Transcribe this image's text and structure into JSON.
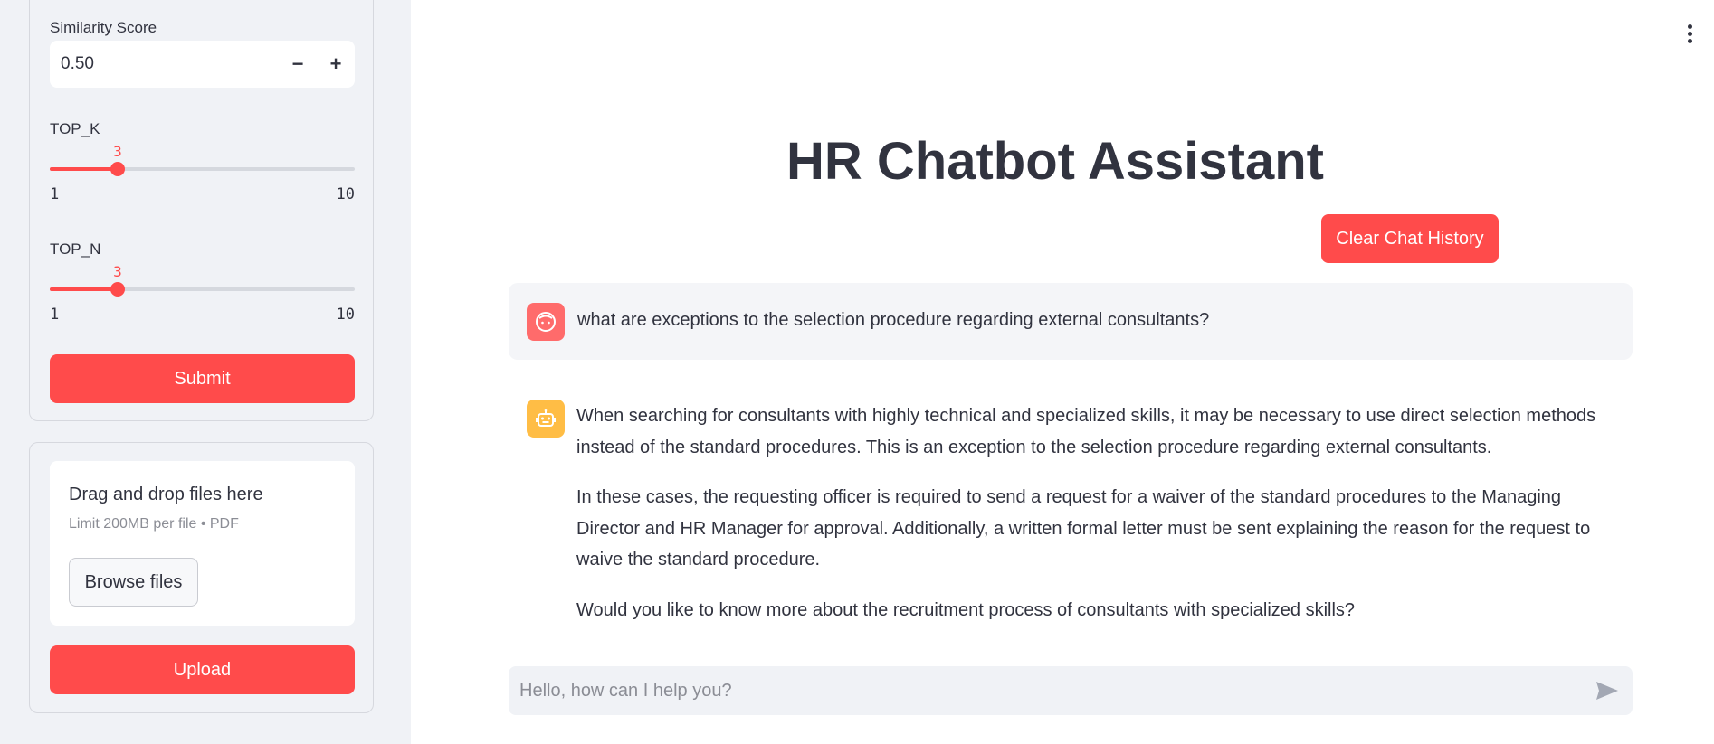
{
  "sidebar": {
    "similarity": {
      "label": "Similarity Score",
      "value": "0.50",
      "minus": "−",
      "plus": "+"
    },
    "top_k": {
      "label": "TOP_K",
      "value": 3,
      "value_text": "3",
      "min_text": "1",
      "max_text": "10",
      "min": 1,
      "max": 10
    },
    "top_n": {
      "label": "TOP_N",
      "value": 3,
      "value_text": "3",
      "min_text": "1",
      "max_text": "10",
      "min": 1,
      "max": 10
    },
    "submit_label": "Submit",
    "uploader": {
      "title": "Drag and drop files here",
      "limit": "Limit 200MB per file • PDF",
      "browse_label": "Browse files"
    },
    "upload_label": "Upload"
  },
  "main": {
    "title": "HR Chatbot Assistant",
    "clear_label": "Clear Chat History",
    "messages": [
      {
        "role": "user",
        "text": "what are exceptions to the selection procedure regarding external consultants?"
      },
      {
        "role": "assistant",
        "paragraphs": [
          "When searching for consultants with highly technical and specialized skills, it may be necessary to use direct selection methods instead of the standard procedures. This is an exception to the selection procedure regarding external consultants.",
          "In these cases, the requesting officer is required to send a request for a waiver of the standard procedures to the Managing Director and HR Manager for approval. Additionally, a written formal letter must be sent explaining the reason for the request to waive the standard procedure.",
          "Would you like to know more about the recruitment process of consultants with specialized skills?"
        ]
      }
    ],
    "chat_placeholder": "Hello, how can I help you?"
  },
  "colors": {
    "accent": "#ff4b4b",
    "user_avatar": "#ff6b6b",
    "bot_avatar": "#ffbd45",
    "sidebar_bg": "#f0f2f6"
  },
  "icons": {
    "user_avatar": "face-icon",
    "bot_avatar": "robot-icon",
    "send": "send-icon",
    "menu": "kebab-menu-icon"
  }
}
